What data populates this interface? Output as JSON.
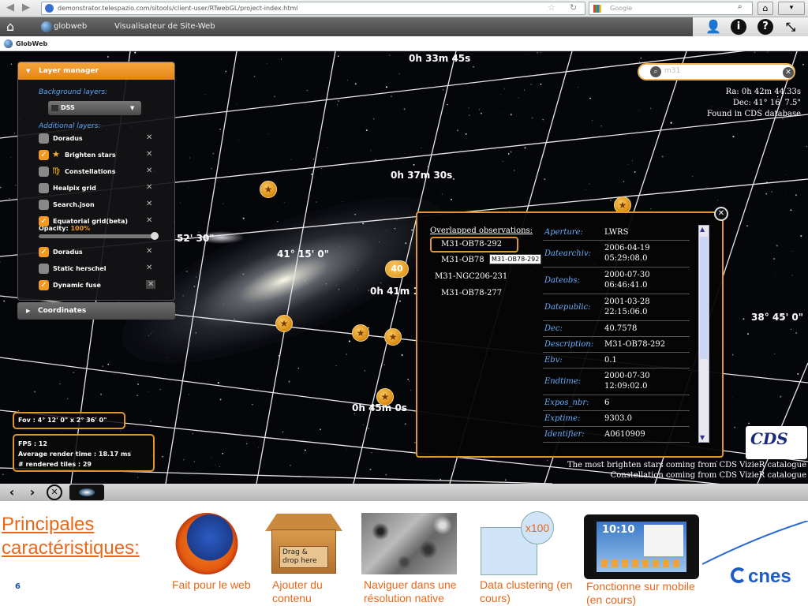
{
  "browser": {
    "url": "demonstrator.telespazio.com/sitools/client-user/RTwebGL/project-index.html",
    "search_engine": "Google"
  },
  "app_nav": {
    "globweb_label": "globweb",
    "viewer_label": "Visualisateur de Site-Web",
    "tab_label": "GlobWeb",
    "icons": [
      "home-icon",
      "user-icon",
      "info-icon",
      "help-icon",
      "collapse-icon"
    ]
  },
  "layer_manager": {
    "title": "Layer manager",
    "background_title": "Background layers:",
    "background_value": "DSS",
    "additional_title": "Additional layers:",
    "layers": [
      {
        "name": "Doradus",
        "checked": false,
        "icon": "none"
      },
      {
        "name": "Brighten stars",
        "checked": true,
        "icon": "star-icon"
      },
      {
        "name": "Constellations",
        "checked": false,
        "icon": "constellation-icon"
      },
      {
        "name": "Healpix grid",
        "checked": false,
        "icon": "none"
      },
      {
        "name": "Search.json",
        "checked": false,
        "icon": "none"
      },
      {
        "name": "Equatorial grid(beta)",
        "checked": true,
        "icon": "none"
      },
      {
        "name": "Doradus",
        "checked": true,
        "icon": "none"
      },
      {
        "name": "Static herschel",
        "checked": false,
        "icon": "none"
      },
      {
        "name": "Dynamic fuse",
        "checked": true,
        "icon": "none"
      }
    ],
    "opacity_label": "Opacity:",
    "opacity_value": "100%",
    "coordinates_label": "Coordinates"
  },
  "grid_labels": {
    "ra_top": "0h 33m 45s",
    "ra_2": "0h 37m 30s",
    "ra_3": "0h 41m 1",
    "ra_4": "0h 45m 0s",
    "dec_1": "41° 15' 0\"",
    "dec_left": "52' 30\"",
    "dec_right": "38° 45' 0\""
  },
  "cluster_marker_label": "40",
  "fov": "Fov : 4° 12' 0\" x 2° 36' 0\"",
  "stats": {
    "fps": "FPS : 12",
    "render_time": "Average render time : 18.17 ms",
    "tiles": "# rendered tiles : 29"
  },
  "search": {
    "query": "m31",
    "ra": "Ra: 0h 42m 44.33s",
    "dec": "Dec: 41° 16' 7.5\"",
    "found": "Found in CDS database"
  },
  "popup": {
    "obs_title": "Overlapped observations:",
    "observations": [
      "M31-OB78-292",
      "M31-OB78",
      "M31-NGC206-231",
      "M31-OB78-277"
    ],
    "tooltip": "M31-OB78-292",
    "props": [
      {
        "k": "Aperture:",
        "v": "LWRS"
      },
      {
        "k": "Datearchiv:",
        "v": "2006-04-19\n05:29:08.0"
      },
      {
        "k": "Dateobs:",
        "v": "2000-07-30\n06:46:41.0"
      },
      {
        "k": "Datepublic:",
        "v": "2001-03-28\n22:15:06.0"
      },
      {
        "k": "Dec:",
        "v": "40.7578"
      },
      {
        "k": "Description:",
        "v": "M31-OB78-292"
      },
      {
        "k": "Ebv:",
        "v": "0.1"
      },
      {
        "k": "Endtime:",
        "v": "2000-07-30\n12:09:02.0"
      },
      {
        "k": "Expos_nbr:",
        "v": "6"
      },
      {
        "k": "Exptime:",
        "v": "9303.0"
      },
      {
        "k": "Identifier:",
        "v": "A0610909"
      }
    ]
  },
  "credits": {
    "line1": "The most brighten stars coming from CDS VizieR catalogue",
    "line2": "Constellation coming from CDS VizieR catalogue",
    "cds_logo": "CDS"
  },
  "slide": {
    "title": "Principales caractéristiques:",
    "page_number": "6",
    "features": [
      {
        "caption": "Fait pour le web",
        "icon": "firefox-icon"
      },
      {
        "caption": "Ajouter du contenu",
        "icon": "box-icon",
        "box_text": "Drag & drop here"
      },
      {
        "caption": "Naviguer dans une résolution native",
        "icon": "moon-surface-image"
      },
      {
        "caption": "Data clustering (en cours)",
        "icon": "cluster-icon",
        "badge": "x100"
      },
      {
        "caption": "Fonctionne sur mobile (en cours)",
        "icon": "tablet-icon",
        "clock": "10:10"
      }
    ],
    "logo_text": "cnes"
  }
}
